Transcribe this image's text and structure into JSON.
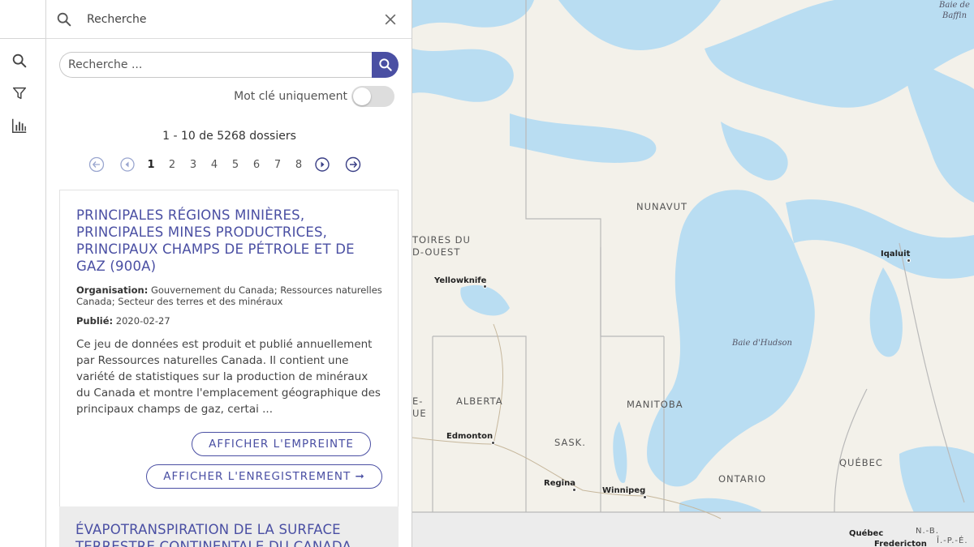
{
  "rail": {
    "items": [
      {
        "name": "search-icon"
      },
      {
        "name": "filter-icon"
      },
      {
        "name": "chart-icon"
      }
    ]
  },
  "panel": {
    "title": "Recherche",
    "search_placeholder": "Recherche ...",
    "keyword_label": "Mot clé uniquement",
    "keyword_on": false,
    "result_count": "1 - 10 de 5268 dossiers",
    "pages": [
      "1",
      "2",
      "3",
      "4",
      "5",
      "6",
      "7",
      "8"
    ],
    "current_page": "1"
  },
  "results": [
    {
      "title": "PRINCIPALES RÉGIONS MINIÈRES, PRINCIPALES MINES PRODUCTRICES, PRINCIPAUX CHAMPS DE PÉTROLE ET DE GAZ (900A)",
      "org_label": "Organisation:",
      "org_value": "Gouvernement du Canada; Ressources naturelles Canada; Secteur des terres et des minéraux",
      "published_label": "Publié:",
      "published_value": "2020-02-27",
      "description": "Ce jeu de données est produit et publié annuellement par Ressources naturelles Canada. Il contient une variété de statistiques sur la production de minéraux du Canada et montre l'emplacement géographique des principaux champs de gaz, certai ...",
      "footprint_button": "AFFICHER L'EMPREINTE",
      "record_button": "AFFICHER L'ENREGISTREMENT ➞"
    },
    {
      "title": "ÉVAPOTRANSPIRATION DE LA SURFACE TERRESTRE CONTINENTALE DU CANADA"
    }
  ],
  "map": {
    "regions": [
      "NUNAVUT",
      "TOIRES DU",
      "D-OUEST",
      "ALBERTA",
      "MANITOBA",
      "SASK.",
      "ONTARIO",
      "QUÉBEC",
      "E-",
      "UE",
      "N.-B.",
      "Î.-P.-É."
    ],
    "cities": [
      "Yellowknife",
      "Iqaluit",
      "Edmonton",
      "Regina",
      "Winnipeg",
      "Québec",
      "Fredericton"
    ],
    "water": [
      "Baie d'Hudson",
      "Baie de Baffin"
    ],
    "colors": {
      "land": "#f3f1ea",
      "water": "#b9ddf2",
      "accent": "#4a4fa3"
    }
  }
}
